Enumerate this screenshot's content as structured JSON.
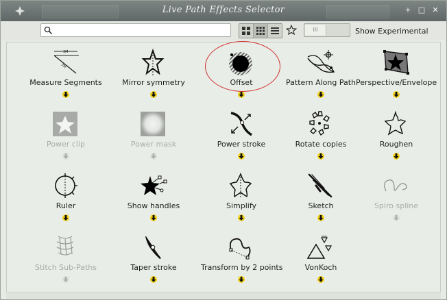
{
  "window": {
    "title": "Live Path Effects Selector",
    "controls": [
      "+",
      "□",
      "✕"
    ]
  },
  "toolbar": {
    "search_value": "",
    "show_experimental_label": "Show Experimental",
    "toggle_state": "off",
    "toggle_knob_text": "III"
  },
  "effects": [
    {
      "label": "Measure Segments",
      "enabled": true,
      "icon": "measure-segments-icon"
    },
    {
      "label": "Mirror symmetry",
      "enabled": true,
      "icon": "mirror-symmetry-icon"
    },
    {
      "label": "Offset",
      "enabled": true,
      "icon": "offset-icon"
    },
    {
      "label": "Pattern Along Path",
      "enabled": true,
      "icon": "pattern-along-path-icon"
    },
    {
      "label": "Perspective/Envelope",
      "enabled": true,
      "icon": "perspective-envelope-icon"
    },
    {
      "label": "Power clip",
      "enabled": false,
      "icon": "power-clip-icon"
    },
    {
      "label": "Power mask",
      "enabled": false,
      "icon": "power-mask-icon"
    },
    {
      "label": "Power stroke",
      "enabled": true,
      "icon": "power-stroke-icon"
    },
    {
      "label": "Rotate copies",
      "enabled": true,
      "icon": "rotate-copies-icon"
    },
    {
      "label": "Roughen",
      "enabled": true,
      "icon": "roughen-icon"
    },
    {
      "label": "Ruler",
      "enabled": true,
      "icon": "ruler-icon"
    },
    {
      "label": "Show handles",
      "enabled": true,
      "icon": "show-handles-icon"
    },
    {
      "label": "Simplify",
      "enabled": true,
      "icon": "simplify-icon"
    },
    {
      "label": "Sketch",
      "enabled": true,
      "icon": "sketch-icon"
    },
    {
      "label": "Spiro spline",
      "enabled": false,
      "icon": "spiro-spline-icon"
    },
    {
      "label": "Stitch Sub-Paths",
      "enabled": false,
      "icon": "stitch-sub-paths-icon"
    },
    {
      "label": "Taper stroke",
      "enabled": true,
      "icon": "taper-stroke-icon"
    },
    {
      "label": "Transform by 2 points",
      "enabled": true,
      "icon": "transform-by-2-points-icon"
    },
    {
      "label": "VonKoch",
      "enabled": true,
      "icon": "vonkoch-icon"
    }
  ],
  "highlighted": "Offset",
  "colors": {
    "arrow": "#f2d21a",
    "highlight": "#d0302f"
  }
}
